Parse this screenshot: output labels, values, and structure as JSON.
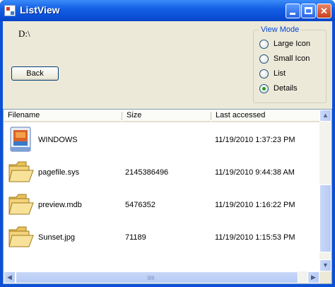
{
  "window": {
    "title": "ListView"
  },
  "path": {
    "text": "D:\\"
  },
  "back_button": {
    "label": "Back"
  },
  "view_mode": {
    "legend": "View Mode",
    "options": [
      {
        "label": "Large Icon",
        "selected": false
      },
      {
        "label": "Small Icon",
        "selected": false
      },
      {
        "label": "List",
        "selected": false
      },
      {
        "label": "Details",
        "selected": true
      }
    ]
  },
  "list": {
    "columns": [
      "Filename",
      "Size",
      "Last accessed"
    ],
    "rows": [
      {
        "icon": "windows-file-icon",
        "name": "WINDOWS",
        "size": "",
        "accessed": "11/19/2010 1:37:23 PM"
      },
      {
        "icon": "folder-icon",
        "name": "pagefile.sys",
        "size": "2145386496",
        "accessed": "11/19/2010 9:44:38 AM"
      },
      {
        "icon": "folder-icon",
        "name": "preview.mdb",
        "size": "5476352",
        "accessed": "11/19/2010 1:16:22 PM"
      },
      {
        "icon": "folder-icon",
        "name": "Sunset.jpg",
        "size": "71189",
        "accessed": "11/19/2010 1:15:53 PM"
      }
    ]
  },
  "colors": {
    "title_bar": "#0a4fd6",
    "dialog_bg": "#ece9d8",
    "radio_selected": "#21a121",
    "legend_text": "#0046d5"
  }
}
